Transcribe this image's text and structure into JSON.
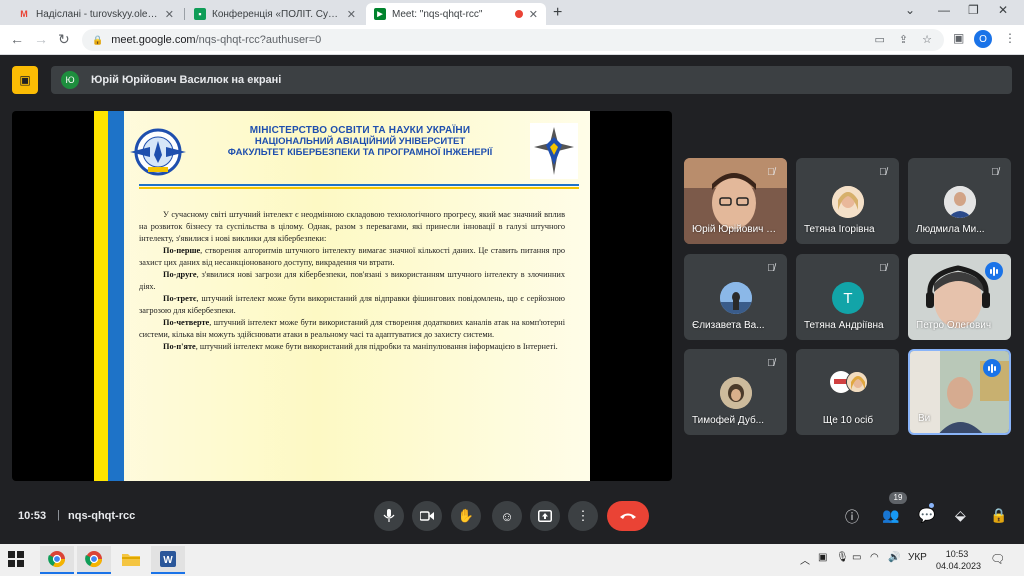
{
  "browser": {
    "tabs": [
      {
        "title": "Надіслані - turovskyy.oleksandr@",
        "favicon": "gmail-icon"
      },
      {
        "title": "Конференція «ПОЛІТ. Сучасні пр",
        "favicon": "classroom-icon"
      },
      {
        "title": "Meet: \"nqs-qhqt-rcc\"",
        "favicon": "meet-icon",
        "active": true
      }
    ],
    "url_host": "meet.google.com",
    "url_path": "/nqs-qhqt-rcc?authuser=0",
    "profile_initial": "O"
  },
  "meet": {
    "presenter_initial": "Ю",
    "presenting_text": "Юрій Юрійович Василюк на екрані",
    "time": "10:53",
    "meeting_code": "nqs-qhqt-rcc",
    "participant_count": "19",
    "participants": [
      {
        "name": "Юрій Юрійович Василюк",
        "muted": true,
        "type": "video"
      },
      {
        "name": "Тетяна Ігорівна",
        "muted": true,
        "type": "photo"
      },
      {
        "name": "Людмила Ми...",
        "muted": true,
        "type": "photo"
      },
      {
        "name": "Єлизавета Ва...",
        "muted": true,
        "type": "photo"
      },
      {
        "name": "Тетяна Андріївна",
        "muted": true,
        "type": "initial",
        "initial": "Т"
      },
      {
        "name": "Петро Олегович",
        "speaking": true,
        "type": "video"
      },
      {
        "name": "Тимофей Дуб...",
        "muted": true,
        "type": "photo"
      },
      {
        "name": "Ще 10 осіб",
        "type": "group"
      },
      {
        "name": "Ви",
        "speaking": true,
        "type": "video",
        "highlighted": true
      }
    ]
  },
  "slide": {
    "header_line1": "МІНІСТЕРСТВО ОСВІТИ ТА НАУКИ УКРАЇНИ",
    "header_line2": "НАЦІОНАЛЬНИЙ АВІАЦІЙНИЙ УНІВЕРСИТЕТ",
    "header_line3": "ФАКУЛЬТЕТ КІБЕРБЕЗПЕКИ ТА ПРОГРАМНОЇ ІНЖЕНЕРІЇ",
    "intro": "У сучасному світі штучний інтелект є неодмінною складовою технологічного прогресу, який має значний вплив на розвиток бізнесу та суспільства в цілому. Однак, разом з перевагами, які принесли інновації в галузі штучного інтелекту, з'явилися і нові виклики для кібербезпеки:",
    "points": [
      {
        "lead": "По-перше",
        "text": ", створення алгоритмів штучного інтелекту вимагає значної кількості даних. Це ставить питання про захист цих даних від несанкціонованого доступу, викрадення чи втрати."
      },
      {
        "lead": "По-друге",
        "text": ", з'явилися нові загрози для кібербезпеки, пов'язані з використанням штучного інтелекту в злочинних діях."
      },
      {
        "lead": "По-третє",
        "text": ", штучний інтелект може бути використаний для відправки фішингових повідомлень, що є серйозною загрозою для кібербезпеки."
      },
      {
        "lead": "По-четверте",
        "text": ", штучний інтелект може бути використаний для створення додаткових каналів атак на комп'ютерні системи, кілька він можуть здійснювати атаки в реальному часі та адаптуватися до захисту системи."
      },
      {
        "lead": "По-п'яте",
        "text": ", штучний інтелект може бути використаний для підробки та маніпулювання інформацією в Інтернеті."
      }
    ]
  },
  "taskbar": {
    "language": "УКР",
    "time": "10:53",
    "date": "04.04.2023"
  },
  "colors": {
    "end_call": "#ea4335",
    "accent": "#1a73e8",
    "cam_off": "#fbbc04",
    "slide_blue": "#1f4fae"
  }
}
